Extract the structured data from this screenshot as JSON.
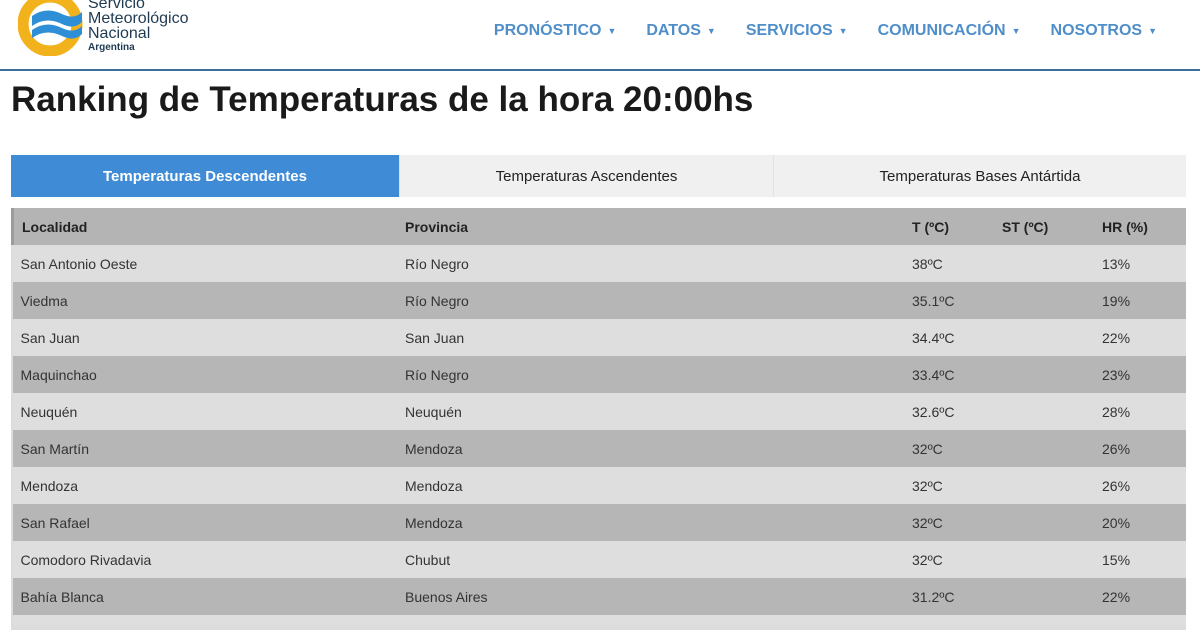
{
  "brand": {
    "line1": "Servicio",
    "line2": "Meteorológico",
    "line3": "Nacional",
    "line4": "Argentina",
    "colors": {
      "sun": "#f2b21b",
      "wave": "#2f8fd6",
      "text": "#1f3a52"
    }
  },
  "nav": [
    {
      "label": "PRONÓSTICO",
      "icon": "caret-down-icon"
    },
    {
      "label": "DATOS",
      "icon": "caret-down-icon"
    },
    {
      "label": "SERVICIOS",
      "icon": "caret-down-icon"
    },
    {
      "label": "COMUNICACIÓN",
      "icon": "caret-down-icon"
    },
    {
      "label": "NOSOTROS",
      "icon": "caret-down-icon"
    }
  ],
  "caret": "▼",
  "page_title": "Ranking de Temperaturas de la hora 20:00hs",
  "tabs": [
    {
      "label": "Temperaturas Descendentes",
      "active": true
    },
    {
      "label": "Temperaturas Ascendentes",
      "active": false
    },
    {
      "label": "Temperaturas Bases Antártida",
      "active": false
    }
  ],
  "accent_color": "#3f8bd6",
  "table": {
    "headers": [
      "Localidad",
      "Provincia",
      "T (ºC)",
      "ST (ºC)",
      "HR (%)"
    ],
    "rows": [
      [
        "San Antonio Oeste",
        "Río Negro",
        "38ºC",
        "",
        "13%"
      ],
      [
        "Viedma",
        "Río Negro",
        "35.1ºC",
        "",
        "19%"
      ],
      [
        "San Juan",
        "San Juan",
        "34.4ºC",
        "",
        "22%"
      ],
      [
        "Maquinchao",
        "Río Negro",
        "33.4ºC",
        "",
        "23%"
      ],
      [
        "Neuquén",
        "Neuquén",
        "32.6ºC",
        "",
        "28%"
      ],
      [
        "San Martín",
        "Mendoza",
        "32ºC",
        "",
        "26%"
      ],
      [
        "Mendoza",
        "Mendoza",
        "32ºC",
        "",
        "26%"
      ],
      [
        "San Rafael",
        "Mendoza",
        "32ºC",
        "",
        "20%"
      ],
      [
        "Comodoro Rivadavia",
        "Chubut",
        "32ºC",
        "",
        "15%"
      ],
      [
        "Bahía Blanca",
        "Buenos Aires",
        "31.2ºC",
        "",
        "22%"
      ]
    ]
  }
}
